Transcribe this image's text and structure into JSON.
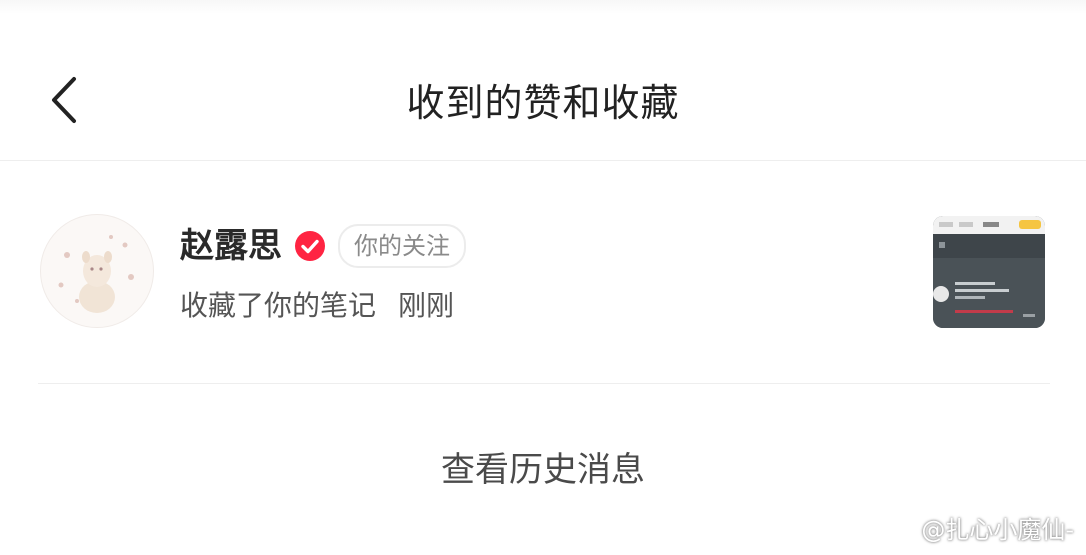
{
  "header": {
    "title": "收到的赞和收藏",
    "back_icon": "chevron-left-icon"
  },
  "notification": {
    "user_name": "赵露思",
    "verified_icon": "verified-check-icon",
    "badge": "你的关注",
    "action": "收藏了你的笔记",
    "time": "刚刚"
  },
  "footer": {
    "history_label": "查看历史消息"
  },
  "watermark": {
    "text": "@扎心小魔仙-",
    "icon": "weibo-logo-icon"
  },
  "colors": {
    "accent_red": "#ff2442",
    "divider": "#eeeeee",
    "title_text": "#222222"
  }
}
